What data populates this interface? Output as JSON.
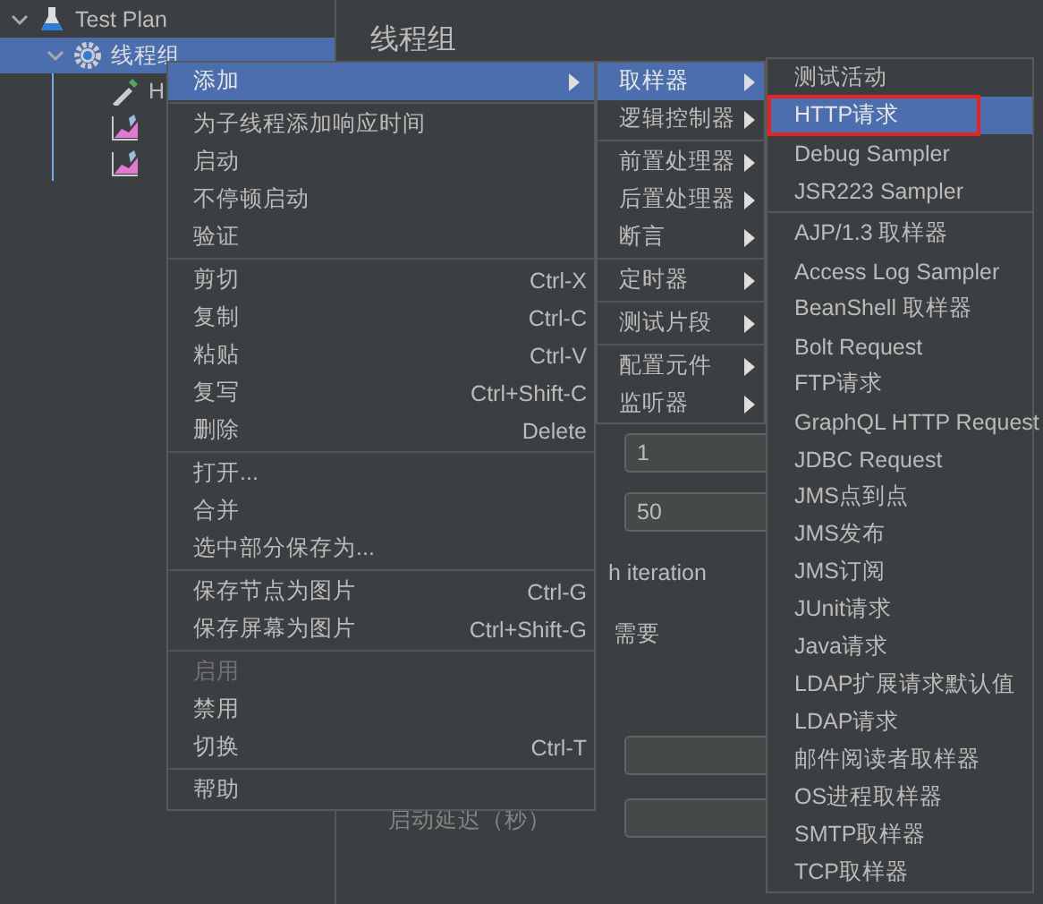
{
  "tree": [
    {
      "label": "Test Plan",
      "kind": "plan",
      "expanded": true,
      "selected": false,
      "children": [
        {
          "label": "线程组",
          "kind": "thread_group",
          "expanded": true,
          "selected": true,
          "children": [
            {
              "label": "H",
              "kind": "sampler",
              "selected": false
            },
            {
              "kind": "listener",
              "selected": false
            },
            {
              "kind": "listener",
              "selected": false
            }
          ]
        }
      ]
    }
  ],
  "panel": {
    "title": "线程组",
    "fields": [
      {
        "kind": "input",
        "value": "1"
      },
      {
        "kind": "input",
        "value": "50"
      },
      {
        "kind": "text",
        "label": "h iteration"
      },
      {
        "kind": "text",
        "label": "需要"
      },
      {
        "kind": "input"
      },
      {
        "kind": "input",
        "label": "启动延迟（秒）"
      }
    ]
  },
  "context_menu": {
    "groups": [
      [
        {
          "label": "添加",
          "submenu": true,
          "selected": true,
          "disabled": false
        }
      ],
      [
        {
          "label": "为子线程添加响应时间",
          "submenu": false,
          "selected": false,
          "disabled": false
        },
        {
          "label": "启动",
          "submenu": false,
          "selected": false,
          "disabled": false
        },
        {
          "label": "不停顿启动",
          "submenu": false,
          "selected": false,
          "disabled": false
        },
        {
          "label": "验证",
          "submenu": false,
          "selected": false,
          "disabled": false
        }
      ],
      [
        {
          "label": "剪切",
          "shortcut": "Ctrl-X",
          "submenu": false,
          "selected": false,
          "disabled": false
        },
        {
          "label": "复制",
          "shortcut": "Ctrl-C",
          "submenu": false,
          "selected": false,
          "disabled": false
        },
        {
          "label": "粘贴",
          "shortcut": "Ctrl-V",
          "submenu": false,
          "selected": false,
          "disabled": false
        },
        {
          "label": "复写",
          "shortcut": "Ctrl+Shift-C",
          "submenu": false,
          "selected": false,
          "disabled": false
        },
        {
          "label": "删除",
          "shortcut": "Delete",
          "submenu": false,
          "selected": false,
          "disabled": false
        }
      ],
      [
        {
          "label": "打开...",
          "submenu": false,
          "selected": false,
          "disabled": false
        },
        {
          "label": "合并",
          "submenu": false,
          "selected": false,
          "disabled": false
        },
        {
          "label": "选中部分保存为...",
          "submenu": false,
          "selected": false,
          "disabled": false
        }
      ],
      [
        {
          "label": "保存节点为图片",
          "shortcut": "Ctrl-G",
          "submenu": false,
          "selected": false,
          "disabled": false
        },
        {
          "label": "保存屏幕为图片",
          "shortcut": "Ctrl+Shift-G",
          "submenu": false,
          "selected": false,
          "disabled": false
        }
      ],
      [
        {
          "label": "启用",
          "submenu": false,
          "selected": false,
          "disabled": true
        },
        {
          "label": "禁用",
          "submenu": false,
          "selected": false,
          "disabled": false
        },
        {
          "label": "切换",
          "shortcut": "Ctrl-T",
          "submenu": false,
          "selected": false,
          "disabled": false
        }
      ],
      [
        {
          "label": "帮助",
          "submenu": false,
          "selected": false,
          "disabled": false
        }
      ]
    ]
  },
  "add_menu": {
    "groups": [
      [
        {
          "label": "取样器",
          "submenu": true,
          "selected": true
        },
        {
          "label": "逻辑控制器",
          "submenu": true,
          "selected": false
        }
      ],
      [
        {
          "label": "前置处理器",
          "submenu": true,
          "selected": false
        },
        {
          "label": "后置处理器",
          "submenu": true,
          "selected": false
        },
        {
          "label": "断言",
          "submenu": true,
          "selected": false
        }
      ],
      [
        {
          "label": "定时器",
          "submenu": true,
          "selected": false
        }
      ],
      [
        {
          "label": "测试片段",
          "submenu": true,
          "selected": false
        }
      ],
      [
        {
          "label": "配置元件",
          "submenu": true,
          "selected": false
        },
        {
          "label": "监听器",
          "submenu": true,
          "selected": false
        }
      ]
    ]
  },
  "sampler_menu": {
    "groups": [
      [
        {
          "label": "测试活动",
          "selected": false,
          "outlined": false
        },
        {
          "label": "HTTP请求",
          "selected": true,
          "outlined": true
        },
        {
          "label": "Debug Sampler",
          "selected": false,
          "outlined": false
        },
        {
          "label": "JSR223 Sampler",
          "selected": false,
          "outlined": false
        }
      ],
      [
        {
          "label": "AJP/1.3 取样器",
          "selected": false,
          "outlined": false
        },
        {
          "label": "Access Log Sampler",
          "selected": false,
          "outlined": false
        },
        {
          "label": "BeanShell 取样器",
          "selected": false,
          "outlined": false
        },
        {
          "label": "Bolt Request",
          "selected": false,
          "outlined": false
        },
        {
          "label": "FTP请求",
          "selected": false,
          "outlined": false
        },
        {
          "label": "GraphQL HTTP Request",
          "selected": false,
          "outlined": false
        },
        {
          "label": "JDBC Request",
          "selected": false,
          "outlined": false
        },
        {
          "label": "JMS点到点",
          "selected": false,
          "outlined": false
        },
        {
          "label": "JMS发布",
          "selected": false,
          "outlined": false
        },
        {
          "label": "JMS订阅",
          "selected": false,
          "outlined": false
        },
        {
          "label": "JUnit请求",
          "selected": false,
          "outlined": false
        },
        {
          "label": "Java请求",
          "selected": false,
          "outlined": false
        },
        {
          "label": "LDAP扩展请求默认值",
          "selected": false,
          "outlined": false
        },
        {
          "label": "LDAP请求",
          "selected": false,
          "outlined": false
        },
        {
          "label": "邮件阅读者取样器",
          "selected": false,
          "outlined": false
        },
        {
          "label": "OS进程取样器",
          "selected": false,
          "outlined": false
        },
        {
          "label": "SMTP取样器",
          "selected": false,
          "outlined": false
        },
        {
          "label": "TCP取样器",
          "selected": false,
          "outlined": false
        }
      ]
    ]
  }
}
